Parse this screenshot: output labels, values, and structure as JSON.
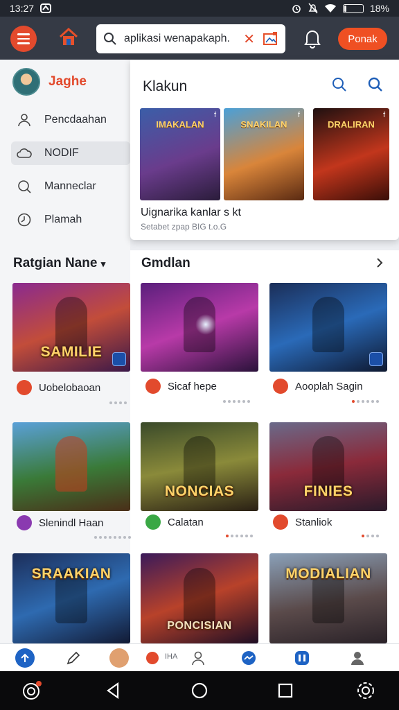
{
  "status_bar": {
    "time": "13:27",
    "battery_text": "18%",
    "battery_level": 0.18
  },
  "top_bar": {
    "search_text": "aplikasi wenapakaph.",
    "login_label": "Ponak"
  },
  "sidebar": {
    "profile_name": "Jaghe",
    "items": [
      {
        "label": "Pencdaahan",
        "icon": "user-icon"
      },
      {
        "label": "NODIF",
        "icon": "cloud-icon",
        "active": true
      },
      {
        "label": "Manneclar",
        "icon": "search-icon"
      },
      {
        "label": "Plamah",
        "icon": "clock-icon"
      }
    ]
  },
  "dropdown": {
    "title": "Klakun",
    "caption": "Uignarika kanlar s kt",
    "meta": "Setabet zpap BIG t.o.G",
    "cards": [
      {
        "title": "IMAKALAN",
        "tag": "f"
      },
      {
        "title": "SNAKILAN",
        "tag": "f"
      },
      {
        "title": "DRALIRAN",
        "tag": "f"
      }
    ]
  },
  "sections": {
    "left_title": "Ratgian Nane",
    "right_title": "Gmdlan"
  },
  "grid": {
    "left_column": [
      {
        "art_title": "SAMILIE",
        "label": "Uobelobaoan",
        "icon_color": "#e24a2d"
      },
      {
        "art_title": "",
        "label": "Slenindl Haan",
        "icon_color": "#8a3ab0"
      },
      {
        "art_title": "SRAAKIAN",
        "label": "",
        "icon_color": ""
      }
    ],
    "middle_column": [
      {
        "art_title": "",
        "label": "Sicaf hepe",
        "icon_color": "#e24a2d"
      },
      {
        "art_title": "NONCIAS",
        "label": "Calatan",
        "icon_color": "#3aa845"
      },
      {
        "art_title": "PONCISIAN",
        "label": "",
        "icon_color": ""
      }
    ],
    "right_column": [
      {
        "art_title": "",
        "label": "Aooplah Sagin",
        "icon_color": "#e24a2d"
      },
      {
        "art_title": "FINIES",
        "label": "Stanliok",
        "icon_color": "#e24a2d"
      },
      {
        "art_title": "MODIALIAN",
        "label": "",
        "icon_color": ""
      }
    ]
  },
  "bottom_tabs": {
    "mid_label": "IHA"
  },
  "colors": {
    "accent": "#ef5023",
    "topbar": "#353a45"
  }
}
